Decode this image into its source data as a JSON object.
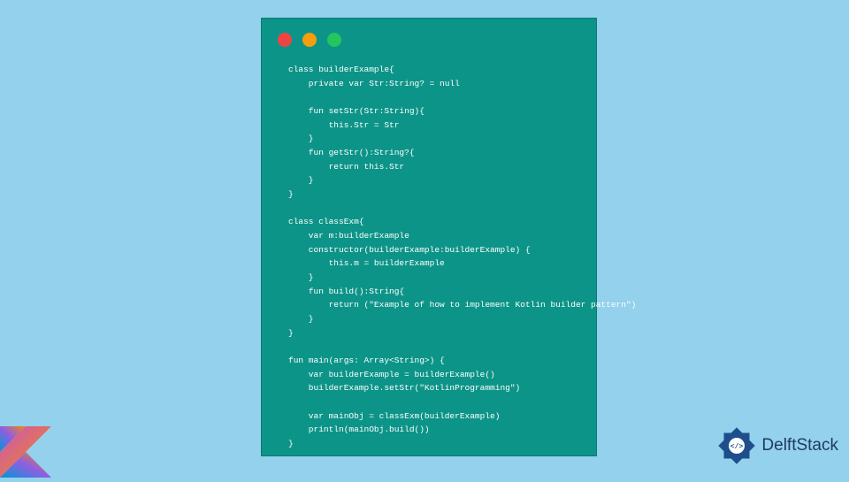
{
  "code_window": {
    "dots": [
      "red",
      "yellow",
      "green"
    ],
    "code": "class builderExample{\n    private var Str:String? = null\n\n    fun setStr(Str:String){\n        this.Str = Str\n    }\n    fun getStr():String?{\n        return this.Str\n    }\n}\n\nclass classExm{\n    var m:builderExample\n    constructor(builderExample:builderExample) {\n        this.m = builderExample\n    }\n    fun build():String{\n        return (\"Example of how to implement Kotlin builder pattern\")\n    }\n}\n\nfun main(args: Array<String>) {\n    var builderExample = builderExample()\n    builderExample.setStr(\"KotlinProgramming\")\n\n    var mainObj = classExm(builderExample)\n    println(mainObj.build())\n}"
  },
  "branding": {
    "site_name": "DelftStack"
  }
}
